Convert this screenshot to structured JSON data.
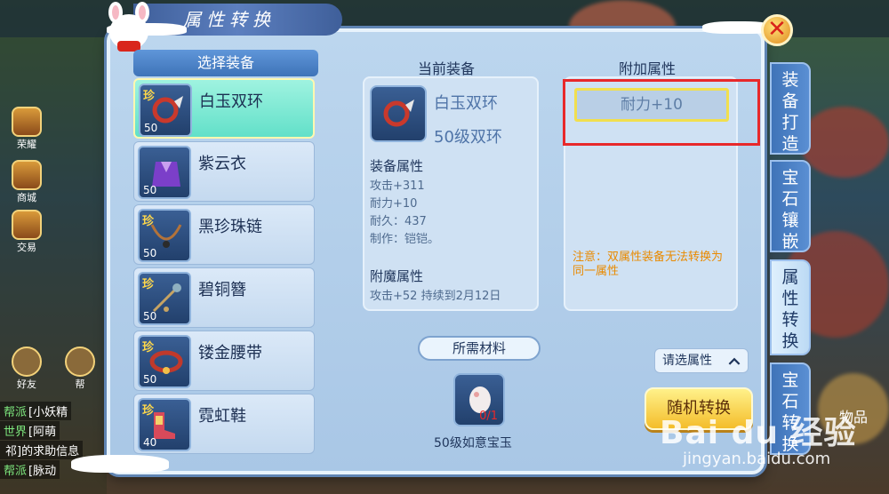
{
  "window": {
    "title": "属性转换",
    "close_glyph": "✕"
  },
  "left_list": {
    "header": "选择装备",
    "items": [
      {
        "rare": "珍",
        "name": "白玉双环",
        "level": "50",
        "selected": true
      },
      {
        "rare": "",
        "name": "紫云衣",
        "level": "50",
        "selected": false
      },
      {
        "rare": "珍",
        "name": "黑珍珠链",
        "level": "50",
        "selected": false
      },
      {
        "rare": "珍",
        "name": "碧铜簪",
        "level": "50",
        "selected": false
      },
      {
        "rare": "珍",
        "name": "镂金腰带",
        "level": "50",
        "selected": false
      },
      {
        "rare": "珍",
        "name": "霓虹鞋",
        "level": "40",
        "selected": false
      }
    ]
  },
  "current": {
    "title": "当前装备",
    "name": "白玉双环",
    "type": "50级双环",
    "attr_title": "装备属性",
    "attrs": [
      "攻击+311",
      "耐力+10",
      "耐久：437",
      "制作：铠铠。"
    ],
    "enchant_title": "附魔属性",
    "enchant": "攻击+52 持续到2月12日"
  },
  "materials": {
    "title": "所需材料",
    "item_name": "50级如意宝玉",
    "count": "0/1"
  },
  "extra": {
    "title": "附加属性",
    "option": "耐力+10",
    "note": "注意：双属性装备无法转换为同一属性",
    "select_label": "请选属性",
    "random_button": "随机转换"
  },
  "tabs": [
    "装备打造",
    "宝石镶嵌",
    "属性转换",
    "宝石转换"
  ],
  "background": {
    "side_labels": [
      "荣耀",
      "商城",
      "交易",
      "好友",
      "帮"
    ],
    "chat": [
      {
        "tag": "帮派",
        "text": "[小妖精"
      },
      {
        "tag": "世界",
        "text": "[阿萌"
      },
      {
        "tag": "",
        "text": "祁]的求助信息"
      },
      {
        "tag": "帮派",
        "text": "[脉动"
      }
    ],
    "goods": "物品"
  },
  "watermark": {
    "logo": "Bai du 经验",
    "url": "jingyan.baidu.com"
  },
  "colors": {
    "highlight": "#e8282a",
    "accent": "#f1df4e",
    "note": "#e98a00"
  }
}
